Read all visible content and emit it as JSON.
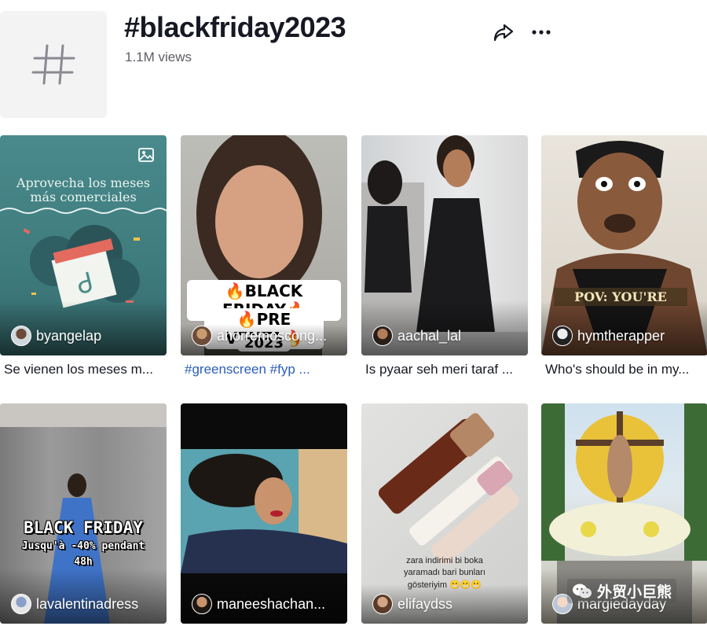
{
  "header": {
    "title": "#blackfriday2023",
    "views": "1.1M views",
    "thumb_icon": "hashtag-icon",
    "share_icon": "share-icon",
    "more_icon": "more-icon"
  },
  "videos": [
    {
      "author": "byangelap",
      "caption": "Se vienen los meses m...",
      "overlay": "Aprovecha los meses\nmás comerciales",
      "badge_icon": "photo-icon"
    },
    {
      "author": "ahorremoscong...",
      "caption": "#greenscreen #fyp ...",
      "overlay_line1": "🔥BLACK FRIDAY🔥",
      "overlay_line2": "🔥PRE VENTA🔥",
      "overlay_line3": "2023"
    },
    {
      "author": "aachal_lal",
      "caption": "Is pyaar seh meri taraf ..."
    },
    {
      "author": "hymtherapper",
      "caption": "Who's should be in my...",
      "overlay": "POV: YOU'RE"
    },
    {
      "author": "lavalentinadress",
      "caption": "",
      "overlay_line1": "BLACK FRIDAY",
      "overlay_line2": "Jusqu'à -40% pendant",
      "overlay_line3": "48h"
    },
    {
      "author": "maneeshachan...",
      "caption": ""
    },
    {
      "author": "elifaydss",
      "caption": "",
      "overlay_line1": "zara indirimi bi boka",
      "overlay_line2": "yaramadı bari bunları",
      "overlay_line3": "gösteriyim 😬😬😬"
    },
    {
      "author": "margiedayday",
      "caption": ""
    }
  ],
  "watermark": {
    "text": "外贸小巨熊",
    "icon": "wechat-icon"
  },
  "colors": {
    "text": "#161823",
    "muted": "#5c5e66",
    "link": "#2b5db9"
  }
}
